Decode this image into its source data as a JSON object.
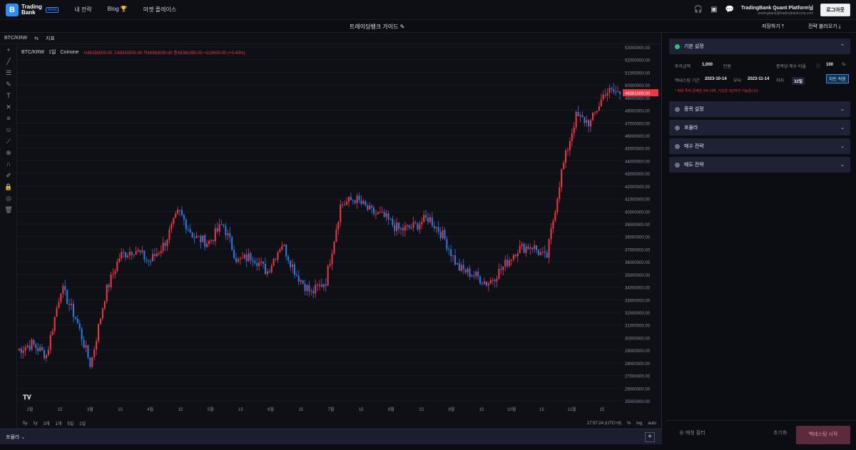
{
  "header": {
    "logo_mark": "B",
    "logo_text": "Trading Bank",
    "beta": "Beta",
    "nav": [
      "내 전략",
      "Blog 🏆",
      "마켓 플레이스"
    ],
    "platform_title": "TradingBank Quant Platform님",
    "platform_email": "tradingbank@tradingbankcorp.com",
    "logout": "로그아웃"
  },
  "subbar": {
    "guide": "트레이딩뱅크 가이드 ✎",
    "save": "저장하기 ⤒",
    "load": "전략 불러오기 ⤓"
  },
  "chart": {
    "symbol_bar": [
      "BTC/KRW",
      "⇆",
      "지표"
    ],
    "legend_symbol": "BTC/KRW",
    "legend_interval": "1일",
    "legend_exchange": "Coinone",
    "legend_ohlc": "시49156000.00  고49410000.00  저48963000.00  종49381000.00 +219000.00 (+0.45%)",
    "price_labels": [
      "53000000.00",
      "52000000.00",
      "51000000.00",
      "50000000.00",
      "49000000.00",
      "48000000.00",
      "47000000.00",
      "46000000.00",
      "45000000.00",
      "44000000.00",
      "43000000.00",
      "42000000.00",
      "41000000.00",
      "40000000.00",
      "39000000.00",
      "38000000.00",
      "37000000.00",
      "36000000.00",
      "35000000.00",
      "34000000.00",
      "33000000.00",
      "32000000.00",
      "31000000.00",
      "30000000.00",
      "29000000.00",
      "28000000.00",
      "27000000.00",
      "26000000.00",
      "25000000.00"
    ],
    "last_price": "49381000.00",
    "time_labels": [
      "2월",
      "15",
      "3월",
      "15",
      "4월",
      "15",
      "5월",
      "15",
      "6월",
      "15",
      "7월",
      "15",
      "8월",
      "15",
      "9월",
      "15",
      "10월",
      "15",
      "11월",
      "15"
    ],
    "ranges": [
      "5y",
      "1y",
      "3개",
      "1개",
      "5일",
      "1일"
    ],
    "clock": "17:57:24 (UTC+9)",
    "pct": "%",
    "log": "log",
    "auto": "auto",
    "tv_mark": "𝐓𝐕"
  },
  "formula": {
    "label": "포뮬라  ⌄",
    "add": "+"
  },
  "panel": {
    "basic": "기본 설정",
    "fund_label": "투자금액",
    "fund_value": "1,000",
    "fund_unit": "만원",
    "fee_label": "종목당 매수 비율",
    "fee_value": "100",
    "fee_unit": "%",
    "period_label": "백테스팅 기간",
    "start": "2023-10-14",
    "tilde": "부터",
    "end": "2023-11-14",
    "to": "까지",
    "days": "32일",
    "chart_apply": "차트 적용",
    "warn": "* 최대 투자 금액은 9억 이하, 기간은 3년까지 가능합니다",
    "sections": [
      "종목 설정",
      "포뮬라",
      "매수 전략",
      "매도 전략"
    ],
    "add_condition": "⊕  매칭 필터",
    "reset": "초기화",
    "run": "백테스팅 시작"
  },
  "chart_data": {
    "type": "candlestick",
    "x_start": "2023-01-25",
    "x_end": "2023-11-14",
    "interval": "1일",
    "ylim": [
      25000000,
      53000000
    ],
    "close_approx": [
      29000000,
      29500000,
      28600000,
      34000000,
      31500000,
      27800000,
      33500000,
      36500000,
      37000000,
      36000000,
      37400000,
      40000000,
      38000000,
      37500000,
      39000000,
      36000000,
      36500000,
      35200000,
      37500000,
      35000000,
      33500000,
      34500000,
      40500000,
      41000000,
      40000000,
      39500000,
      38500000,
      38800000,
      39500000,
      38000000,
      35500000,
      35000000,
      34300000,
      35500000,
      37000000,
      37300000,
      36200000,
      43000000,
      47500000,
      47000000,
      49500000,
      49381000
    ],
    "colors": {
      "up": "#f23645",
      "down": "#2b7ae0"
    }
  }
}
